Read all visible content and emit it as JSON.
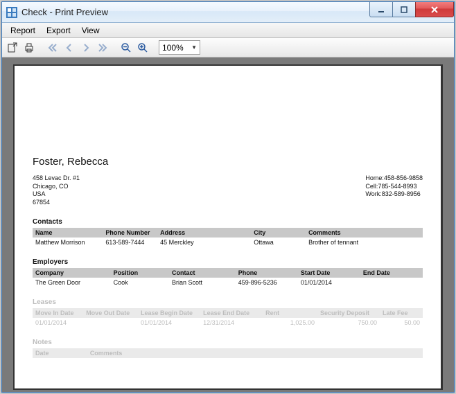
{
  "window": {
    "title": "Check - Print Preview"
  },
  "menu": {
    "report": "Report",
    "export": "Export",
    "view": "View"
  },
  "toolbar": {
    "zoom_value": "100%"
  },
  "report": {
    "tenant_name": "Foster, Rebecca",
    "address": {
      "line1": "458 Levac Dr. #1",
      "line2": "Chicago, CO",
      "line3": "USA",
      "line4": "67854"
    },
    "phones": {
      "home_label": "Home:",
      "home": "458-856-9858",
      "cell_label": "Cell:",
      "cell": "785-544-8993",
      "work_label": "Work:",
      "work": "832-589-8956"
    },
    "contacts": {
      "heading": "Contacts",
      "headers": {
        "name": "Name",
        "phone": "Phone Number",
        "address": "Address",
        "city": "City",
        "comments": "Comments"
      },
      "rows": [
        {
          "name": "Matthew Morrison",
          "phone": "613-589-7444",
          "address": "45 Merckley",
          "city": "Ottawa",
          "comments": "Brother of tennant"
        }
      ]
    },
    "employers": {
      "heading": "Employers",
      "headers": {
        "company": "Company",
        "position": "Position",
        "contact": "Contact",
        "phone": "Phone",
        "start": "Start Date",
        "end": "End Date"
      },
      "rows": [
        {
          "company": "The Green Door",
          "position": "Cook",
          "contact": "Brian Scott",
          "phone": "459-896-5236",
          "start": "01/01/2014",
          "end": ""
        }
      ]
    },
    "leases": {
      "heading": "Leases",
      "headers": {
        "movein": "Move In Date",
        "moveout": "Move Out Date",
        "lbegin": "Lease Begin Date",
        "lend": "Lease End Date",
        "rent": "Rent",
        "deposit": "Security Deposit",
        "late": "Late Fee"
      },
      "rows": [
        {
          "movein": "01/01/2014",
          "moveout": "",
          "lbegin": "01/01/2014",
          "lend": "12/31/2014",
          "rent": "1,025.00",
          "deposit": "750.00",
          "late": "50.00"
        }
      ]
    },
    "notes": {
      "heading": "Notes",
      "headers": {
        "date": "Date",
        "comments": "Comments"
      }
    }
  }
}
